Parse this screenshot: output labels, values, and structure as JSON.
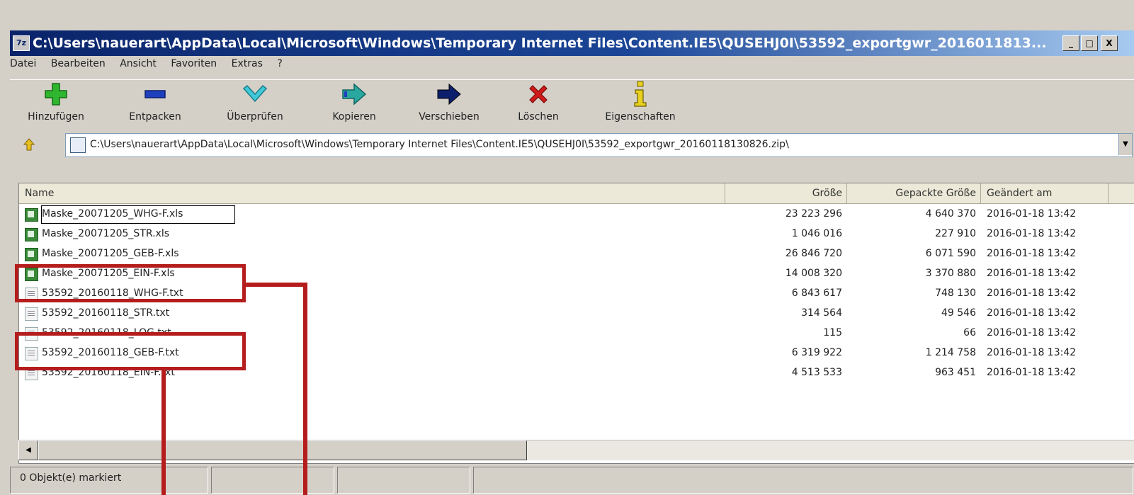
{
  "window": {
    "title": "C:\\Users\\nauerart\\AppData\\Local\\Microsoft\\Windows\\Temporary Internet Files\\Content.IE5\\QUSEHJ0I\\53592_exportgwr_2016011813...",
    "app_icon": "7z",
    "buttons": {
      "minimize": "_",
      "maximize": "□",
      "close": "X"
    }
  },
  "menu": [
    "Datei",
    "Bearbeiten",
    "Ansicht",
    "Favoriten",
    "Extras",
    "?"
  ],
  "toolbar": [
    {
      "label": "Hinzufügen",
      "icon": "plus-icon"
    },
    {
      "label": "Entpacken",
      "icon": "minus-icon"
    },
    {
      "label": "Überprüfen",
      "icon": "check-icon"
    },
    {
      "label": "Kopieren",
      "icon": "copy-arrow-icon"
    },
    {
      "label": "Verschieben",
      "icon": "move-arrow-icon"
    },
    {
      "label": "Löschen",
      "icon": "delete-x-icon"
    },
    {
      "label": "Eigenschaften",
      "icon": "info-icon"
    }
  ],
  "address": {
    "path": "C:\\Users\\nauerart\\AppData\\Local\\Microsoft\\Windows\\Temporary Internet Files\\Content.IE5\\QUSEHJ0I\\53592_exportgwr_20160118130826.zip\\"
  },
  "columns": {
    "name": "Name",
    "size": "Größe",
    "packed": "Gepackte Größe",
    "modified": "Geändert am"
  },
  "files": [
    {
      "name": "Maske_20071205_WHG-F.xls",
      "type": "xls",
      "size": "23 223 296",
      "packed": "4 640 370",
      "modified": "2016-01-18 13:42"
    },
    {
      "name": "Maske_20071205_STR.xls",
      "type": "xls",
      "size": "1 046 016",
      "packed": "227 910",
      "modified": "2016-01-18 13:42"
    },
    {
      "name": "Maske_20071205_GEB-F.xls",
      "type": "xls",
      "size": "26 846 720",
      "packed": "6 071 590",
      "modified": "2016-01-18 13:42"
    },
    {
      "name": "Maske_20071205_EIN-F.xls",
      "type": "xls",
      "size": "14 008 320",
      "packed": "3 370 880",
      "modified": "2016-01-18 13:42"
    },
    {
      "name": "53592_20160118_WHG-F.txt",
      "type": "txt",
      "size": "6 843 617",
      "packed": "748 130",
      "modified": "2016-01-18 13:42"
    },
    {
      "name": "53592_20160118_STR.txt",
      "type": "txt",
      "size": "314 564",
      "packed": "49 546",
      "modified": "2016-01-18 13:42"
    },
    {
      "name": "53592_20160118_LOG.txt",
      "type": "txt",
      "size": "115",
      "packed": "66",
      "modified": "2016-01-18 13:42"
    },
    {
      "name": "53592_20160118_GEB-F.txt",
      "type": "txt",
      "size": "6 319 922",
      "packed": "1 214 758",
      "modified": "2016-01-18 13:42"
    },
    {
      "name": "53592_20160118_EIN-F.txt",
      "type": "txt",
      "size": "4 513 533",
      "packed": "963 451",
      "modified": "2016-01-18 13:42"
    }
  ],
  "status": {
    "selected": "0 Objekt(e) markiert"
  },
  "colors": {
    "annotation": "#b51c1c",
    "title_bar": "#0a246a"
  }
}
